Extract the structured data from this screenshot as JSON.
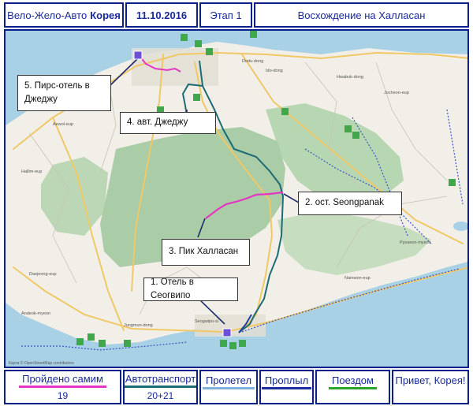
{
  "header": {
    "title_prefix": "Вело-Жело-Авто",
    "title_country": "Корея",
    "date": "11.10.2016",
    "stage": "Этап 1",
    "route_name": "Восхождение на Халласан"
  },
  "map": {
    "waypoints": [
      {
        "label": "1. Отель в Сеогвипо"
      },
      {
        "label": "2. ост. Seongpanak"
      },
      {
        "label": "3. Пик Халласан"
      },
      {
        "label": "4. авт. Джеджу"
      },
      {
        "label": "5. Пирс-отель в Джеджу"
      }
    ],
    "place_labels": [
      "Dodu-dong",
      "Ido-dong",
      "Hwabuk-dong",
      "Jocheon-eup",
      "Aewol-eup",
      "Hallim-eup",
      "Seogwipo-si",
      "Namwon-eup",
      "Pyoseon-myeon",
      "Andeok-myeon",
      "Daejeong-eup",
      "Jungmun-dong"
    ],
    "colors": {
      "water": "#a9d1e6",
      "land": "#f1efe8",
      "forest": "#9dc59a",
      "road": "#f0c866",
      "route_transport": "#1d6b74",
      "route_walk": "#e535c5",
      "route_bus": "#2340a8",
      "bus_dots": "#3755c8"
    },
    "attribution": "Карта © OpenStreetMap contributors"
  },
  "footer": {
    "walked": {
      "label": "Пройдено самим",
      "value": "19",
      "color": "#e535c5"
    },
    "transport": {
      "label": "Автотранспорт",
      "value": "20+21",
      "color": "#1d6b74"
    },
    "flown": {
      "label": "Пролетел",
      "color": "#7fb0dd"
    },
    "sailed": {
      "label": "Проплыл",
      "color": "#1d2fa0"
    },
    "train": {
      "label": "Поездом",
      "color": "#2aa52a"
    },
    "greeting": "Привет, Корея!"
  }
}
